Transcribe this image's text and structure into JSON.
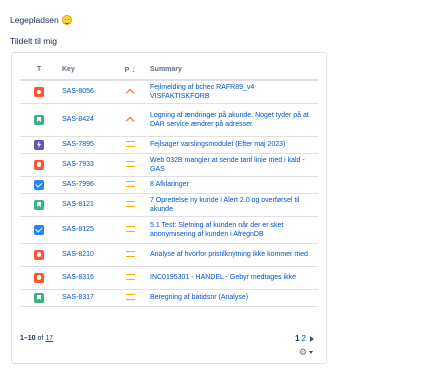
{
  "gadget": {
    "title": "Legepladsen",
    "subtitle": "Tildelt til mig"
  },
  "table": {
    "headers": {
      "type": "T",
      "key": "Key",
      "priority": "P",
      "summary": "Summary"
    },
    "rows": [
      {
        "type": "bug",
        "key": "SAS-8056",
        "priority": "high",
        "summary": "Fejlmelding af bchec RAFR89_v4 VISFAKTISKFORB"
      },
      {
        "type": "story",
        "key": "SAS-8424",
        "priority": "high",
        "summary": "Logning af ændringer på akunde. Noget tyder på at DAR service ændrer på adresser."
      },
      {
        "type": "epic",
        "key": "SAS-7895",
        "priority": "medium",
        "summary": "Fejlsager varslingsmodulet (Efter maj 2023)"
      },
      {
        "type": "bug",
        "key": "SAS-7933",
        "priority": "medium",
        "summary": "Web 032B mangler at sende tarif linie med i kald - GAS"
      },
      {
        "type": "task",
        "key": "SAS-7996",
        "priority": "medium",
        "summary": "8 Afklaringer"
      },
      {
        "type": "story",
        "key": "SAS-8121",
        "priority": "medium",
        "summary": "7 Oprettelse ny kunde i Alert 2.0 og overførsel til akunde"
      },
      {
        "type": "task",
        "key": "SAS-8125",
        "priority": "medium",
        "summary": "5.1 Test: Sletning af kunden når der er sket anonymisering af kunden i AfregnDB"
      },
      {
        "type": "bug",
        "key": "SAS-8210",
        "priority": "medium",
        "summary": "Analyse af hvorfor pristilknytning ikke kommer med"
      },
      {
        "type": "bug",
        "key": "SAS-8316",
        "priority": "medium",
        "summary": "INC0195301 - HANDEL - Gebyr medtages ikke"
      },
      {
        "type": "story",
        "key": "SAS-8317",
        "priority": "medium",
        "summary": "Beregning af batidsnr (Analyse)"
      }
    ]
  },
  "type_colors": {
    "bug": "#ff5630",
    "story": "#36b37e",
    "task": "#2684ff",
    "epic": "#6554c0"
  },
  "footer": {
    "range": "1–10",
    "of_label": "of",
    "total": "17",
    "pages": [
      "1",
      "2"
    ]
  }
}
